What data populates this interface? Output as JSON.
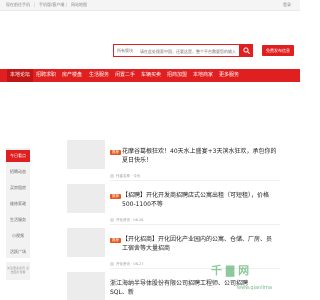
{
  "topbar": {
    "links": [
      "现在前往手机",
      "手机版/客户端",
      "网站地图"
    ],
    "login": "登录"
  },
  "search": {
    "category": "所有版块",
    "placeholder": "请在此处搜索中国，还要这是，整个平台需要您的输入"
  },
  "post_button": "免费发布信息",
  "nav": {
    "items": [
      "本地论坛",
      "招聘求职",
      "房产楼盘",
      "生活服务",
      "闲置二手",
      "车辆买卖",
      "招商加盟",
      "本地商家",
      "更多服务"
    ],
    "active_index": 0
  },
  "sidebar": {
    "items": [
      "今日看点",
      "招聘动态",
      "买房租房",
      "维修家政",
      "生活服务",
      "小视频",
      "活跃广场"
    ],
    "active_index": 0,
    "ad_text": "关注更多资讯 点击图片查看"
  },
  "articles": [
    {
      "tag": "推荐",
      "title": "花摩谷葛根狂欢！40天水上盛宴+3天滨水狂欢，承包你的夏日快乐！",
      "meta": "作者名称 · 今天"
    },
    {
      "tag": "推荐",
      "title": "【招聘】开化开发商招聘店式公寓出租（可短租），价格500-1100不等",
      "meta": "开化资讯 · 06-28"
    },
    {
      "tag": "推荐",
      "title": "【开化招商】开化因化产业园内的公寓、仓储、厂房、员工宿舍等大量招商",
      "meta": "开化资讯 · 06-27"
    },
    {
      "tag": "推荐",
      "title": "浙江海纳半导体股份有限公司招聘工程师、公司招聘SQL、新",
      "meta": "开化资讯 · 06-26"
    }
  ],
  "colors": {
    "brand_red": "#e02020",
    "tag_orange": "#e9571b",
    "watermark_green": "#2f9e4c"
  }
}
